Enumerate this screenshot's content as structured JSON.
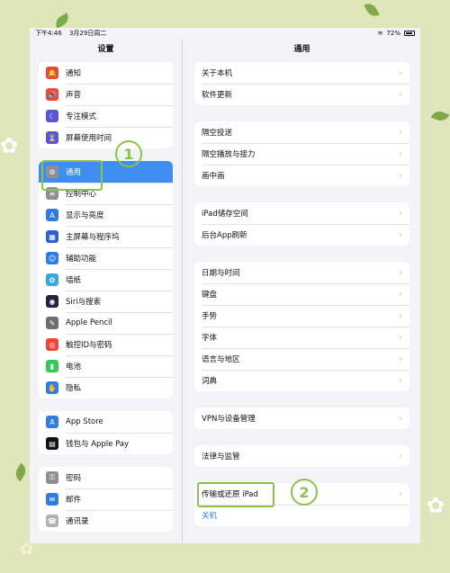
{
  "status": {
    "time": "下午4:46",
    "date": "3月29日周二",
    "battery": "72%"
  },
  "sidebar": {
    "title": "设置",
    "groups": [
      [
        {
          "label": "通知",
          "icon": "bell-icon",
          "color": "#f0453a",
          "glyph": "🔔"
        },
        {
          "label": "声音",
          "icon": "speaker-icon",
          "color": "#f0453a",
          "glyph": "🔊"
        },
        {
          "label": "专注模式",
          "icon": "moon-icon",
          "color": "#5a56d6",
          "glyph": "☾"
        },
        {
          "label": "屏幕使用时间",
          "icon": "hourglass-icon",
          "color": "#5a56d6",
          "glyph": "⌛"
        }
      ],
      [
        {
          "label": "通用",
          "icon": "gear-icon",
          "color": "#8e8e93",
          "glyph": "⚙"
        },
        {
          "label": "控制中心",
          "icon": "switches-icon",
          "color": "#8e8e93",
          "glyph": "≡"
        },
        {
          "label": "显示与亮度",
          "icon": "text-size-icon",
          "color": "#2f7de1",
          "glyph": "A"
        },
        {
          "label": "主屏幕与程序坞",
          "icon": "grid-icon",
          "color": "#2f5fd6",
          "glyph": "▦"
        },
        {
          "label": "辅助功能",
          "icon": "accessibility-icon",
          "color": "#2f7de1",
          "glyph": "☺"
        },
        {
          "label": "墙纸",
          "icon": "flower-icon",
          "color": "#35aadc",
          "glyph": "✿"
        },
        {
          "label": "Siri与搜索",
          "icon": "siri-icon",
          "color": "#222244",
          "glyph": "◉"
        },
        {
          "label": "Apple Pencil",
          "icon": "pencil-icon",
          "color": "#6e6e73",
          "glyph": "✎"
        },
        {
          "label": "触控ID与密码",
          "icon": "fingerprint-icon",
          "color": "#f0453a",
          "glyph": "◎"
        },
        {
          "label": "电池",
          "icon": "battery-icon",
          "color": "#34c759",
          "glyph": "▮"
        },
        {
          "label": "隐私",
          "icon": "hand-icon",
          "color": "#2f7de1",
          "glyph": "✋"
        }
      ],
      [
        {
          "label": "App Store",
          "icon": "appstore-icon",
          "color": "#2f7de1",
          "glyph": "A"
        },
        {
          "label": "钱包与 Apple Pay",
          "icon": "wallet-icon",
          "color": "#111111",
          "glyph": "▤"
        }
      ],
      [
        {
          "label": "密码",
          "icon": "key-icon",
          "color": "#8e8e93",
          "glyph": "⚿"
        },
        {
          "label": "邮件",
          "icon": "mail-icon",
          "color": "#2f7de1",
          "glyph": "✉"
        },
        {
          "label": "通讯录",
          "icon": "contacts-icon",
          "color": "#b0b0b5",
          "glyph": "☎"
        }
      ]
    ]
  },
  "content": {
    "title": "通用",
    "groups": [
      [
        "关于本机",
        "软件更新"
      ],
      [
        "隔空投送",
        "隔空播放与接力",
        "画中画"
      ],
      [
        "iPad储存空间",
        "后台App刷新"
      ],
      [
        "日期与时间",
        "键盘",
        "手势",
        "字体",
        "语言与地区",
        "词典"
      ],
      [
        "VPN与设备管理"
      ],
      [
        "法律与监管"
      ],
      [
        "传输或还原 iPad"
      ]
    ],
    "shutdown": "关机"
  },
  "annotations": {
    "one": "1",
    "two": "2"
  }
}
